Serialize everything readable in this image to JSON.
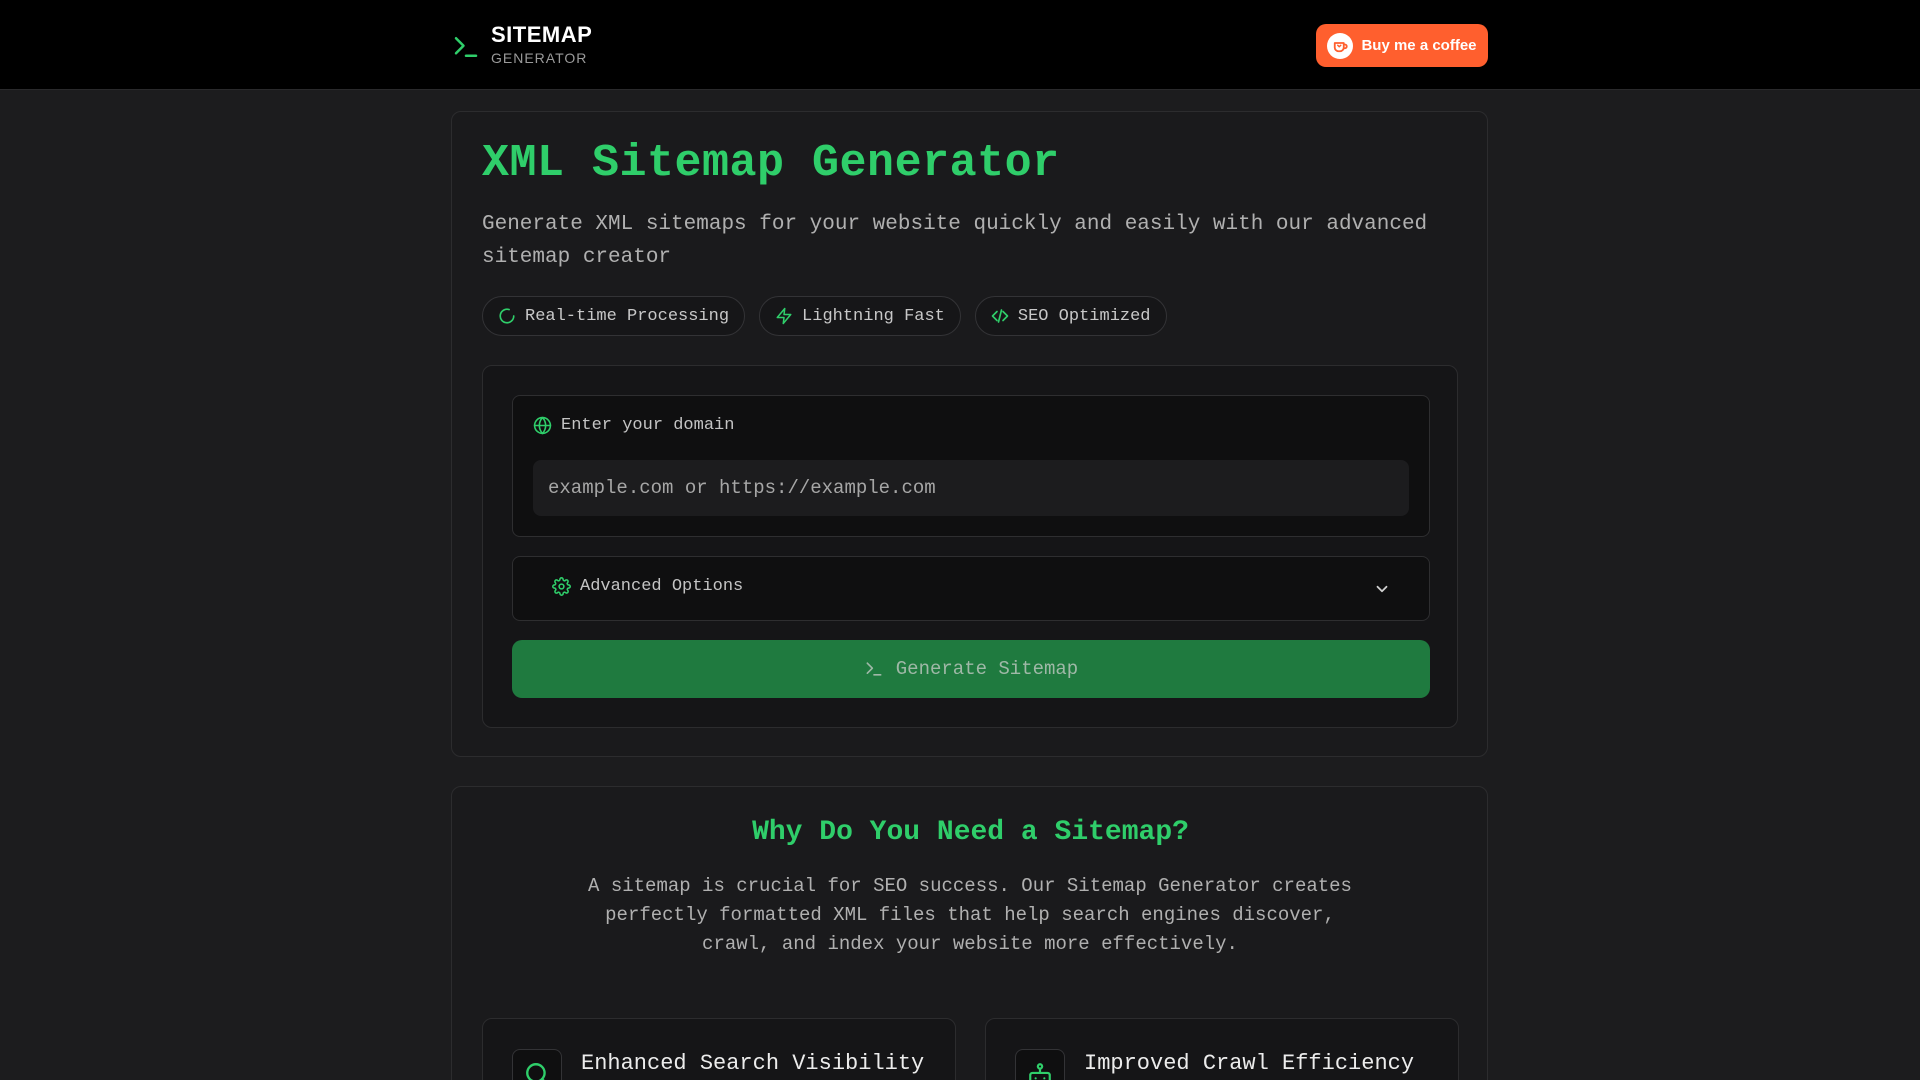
{
  "header": {
    "brand_title": "SITEMAP",
    "brand_subtitle": "GENERATOR",
    "coffee_label": "Buy me a coffee"
  },
  "hero": {
    "title": "XML Sitemap Generator",
    "description": "Generate XML sitemaps for your website quickly and easily with our advanced sitemap creator",
    "badges": [
      {
        "label": "Real-time Processing",
        "icon": "loader-icon"
      },
      {
        "label": "Lightning Fast",
        "icon": "zap-icon"
      },
      {
        "label": "SEO Optimized",
        "icon": "code-icon"
      }
    ]
  },
  "form": {
    "domain_label": "Enter your domain",
    "domain_value": "",
    "domain_placeholder": "example.com or https://example.com",
    "advanced_label": "Advanced Options",
    "generate_label": "Generate Sitemap"
  },
  "why": {
    "title": "Why Do You Need a Sitemap?",
    "description": "A sitemap is crucial for SEO success. Our Sitemap Generator creates perfectly formatted XML files that help search engines discover, crawl, and index your website more effectively.",
    "features": [
      {
        "title": "Enhanced Search Visibility",
        "icon": "search-icon"
      },
      {
        "title": "Improved Crawl Efficiency",
        "icon": "bot-icon"
      }
    ]
  },
  "colors": {
    "accent": "#2fce6a",
    "button_green": "#1f7a3f",
    "coffee_orange": "#ff5f2e",
    "background": "#1c1c1e"
  }
}
